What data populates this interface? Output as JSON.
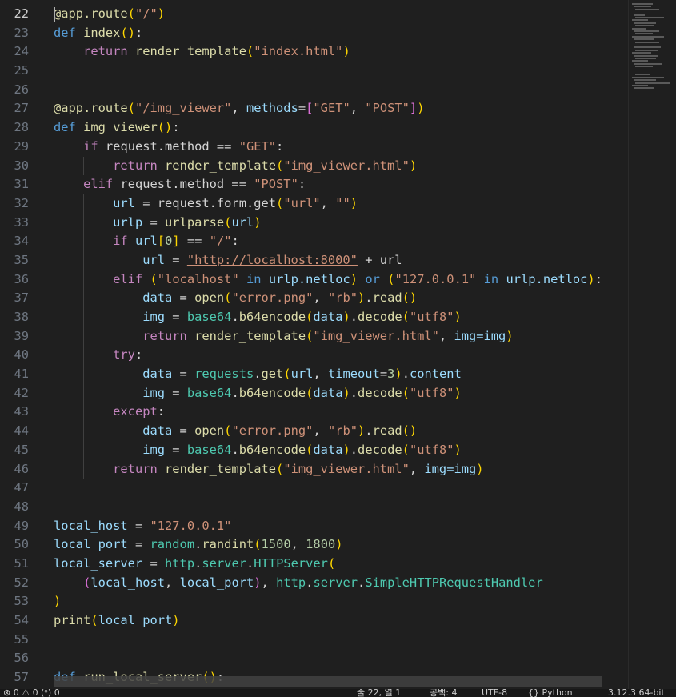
{
  "editor": {
    "active_line": 22,
    "line_numbers": [
      "22",
      "23",
      "24",
      "25",
      "26",
      "27",
      "28",
      "29",
      "30",
      "31",
      "32",
      "33",
      "34",
      "35",
      "36",
      "37",
      "38",
      "39",
      "40",
      "41",
      "42",
      "43",
      "44",
      "45",
      "46",
      "47",
      "48",
      "49",
      "50",
      "51",
      "52",
      "53",
      "54",
      "55",
      "56",
      "57"
    ]
  },
  "code": {
    "l22": {
      "decorator": "@app.route",
      "arg": "\"/\""
    },
    "l23": {
      "kw": "def",
      "name": "index"
    },
    "l24": {
      "kw": "return",
      "fn": "render_template",
      "arg": "\"index.html\""
    },
    "l27": {
      "decorator": "@app.route",
      "arg1": "\"/img_viewer\"",
      "param": "methods",
      "arg2": "\"GET\"",
      "arg3": "\"POST\""
    },
    "l28": {
      "kw": "def",
      "name": "img_viewer"
    },
    "l29": {
      "kw": "if",
      "text": "request.method == ",
      "str": "\"GET\""
    },
    "l30": {
      "kw": "return",
      "fn": "render_template",
      "arg": "\"img_viewer.html\""
    },
    "l31": {
      "kw": "elif",
      "text": "request.method == ",
      "str": "\"POST\""
    },
    "l32": {
      "var": "url",
      "call": "request.form.get",
      "arg1": "\"url\"",
      "arg2": "\"\""
    },
    "l33": {
      "var": "urlp",
      "fn": "urlparse",
      "arg": "url"
    },
    "l34": {
      "kw": "if",
      "var": "url",
      "idx": "0",
      "op": " == ",
      "str": "\"/\""
    },
    "l35": {
      "var": "url",
      "str": "\"http://localhost:8000\"",
      "rest": " + url"
    },
    "l36": {
      "kw": "elif",
      "s1": "\"localhost\"",
      "in1": "in",
      "v1": "urlp.netloc",
      "or": "or",
      "s2": "\"127.0.0.1\"",
      "in2": "in",
      "v2": "urlp.netloc"
    },
    "l37": {
      "var": "data",
      "fn": "open",
      "a1": "\"error.png\"",
      "a2": "\"rb\"",
      "m": "read"
    },
    "l38": {
      "var": "img",
      "mod": "base64",
      "fn": "b64encode",
      "a": "data",
      "m": "decode",
      "s": "\"utf8\""
    },
    "l39": {
      "kw": "return",
      "fn": "render_template",
      "a": "\"img_viewer.html\"",
      "kwarg": "img=img"
    },
    "l40": {
      "kw": "try"
    },
    "l41": {
      "var": "data",
      "mod": "requests",
      "fn": "get",
      "a": "url",
      "kwarg": "timeout",
      "num": "3",
      "attr": "content"
    },
    "l42": {
      "var": "img",
      "mod": "base64",
      "fn": "b64encode",
      "a": "data",
      "m": "decode",
      "s": "\"utf8\""
    },
    "l43": {
      "kw": "except"
    },
    "l44": {
      "var": "data",
      "fn": "open",
      "a1": "\"error.png\"",
      "a2": "\"rb\"",
      "m": "read"
    },
    "l45": {
      "var": "img",
      "mod": "base64",
      "fn": "b64encode",
      "a": "data",
      "m": "decode",
      "s": "\"utf8\""
    },
    "l46": {
      "kw": "return",
      "fn": "render_template",
      "a": "\"img_viewer.html\"",
      "kwarg": "img=img"
    },
    "l49": {
      "var": "local_host",
      "str": "\"127.0.0.1\""
    },
    "l50": {
      "var": "local_port",
      "mod": "random",
      "fn": "randint",
      "n1": "1500",
      "n2": "1800"
    },
    "l51": {
      "var": "local_server",
      "mod": "http",
      "sub": "server",
      "cls": "HTTPServer"
    },
    "l52": {
      "a1": "local_host",
      "a2": "local_port",
      "mod": "http",
      "sub": "server",
      "cls": "SimpleHTTPRequestHandler"
    },
    "l53": {
      "close": ")"
    },
    "l54": {
      "fn": "print",
      "a": "local_port"
    },
    "l57": {
      "kw": "def",
      "name": "run_local_server"
    }
  },
  "statusbar": {
    "left": "⊗ 0 ⚠ 0   (ᵒ) 0",
    "position": "줄 22, 열 1",
    "spaces": "공백: 4",
    "encoding": "UTF-8",
    "language": "{} Python",
    "interpreter": "3.12.3 64-bit"
  },
  "colors": {
    "background": "#1f1f1f",
    "keyword": "#569cd6",
    "control": "#c586c0",
    "function": "#dcdcaa",
    "string": "#ce9178",
    "variable": "#9cdcfe",
    "number": "#b5cea8"
  }
}
